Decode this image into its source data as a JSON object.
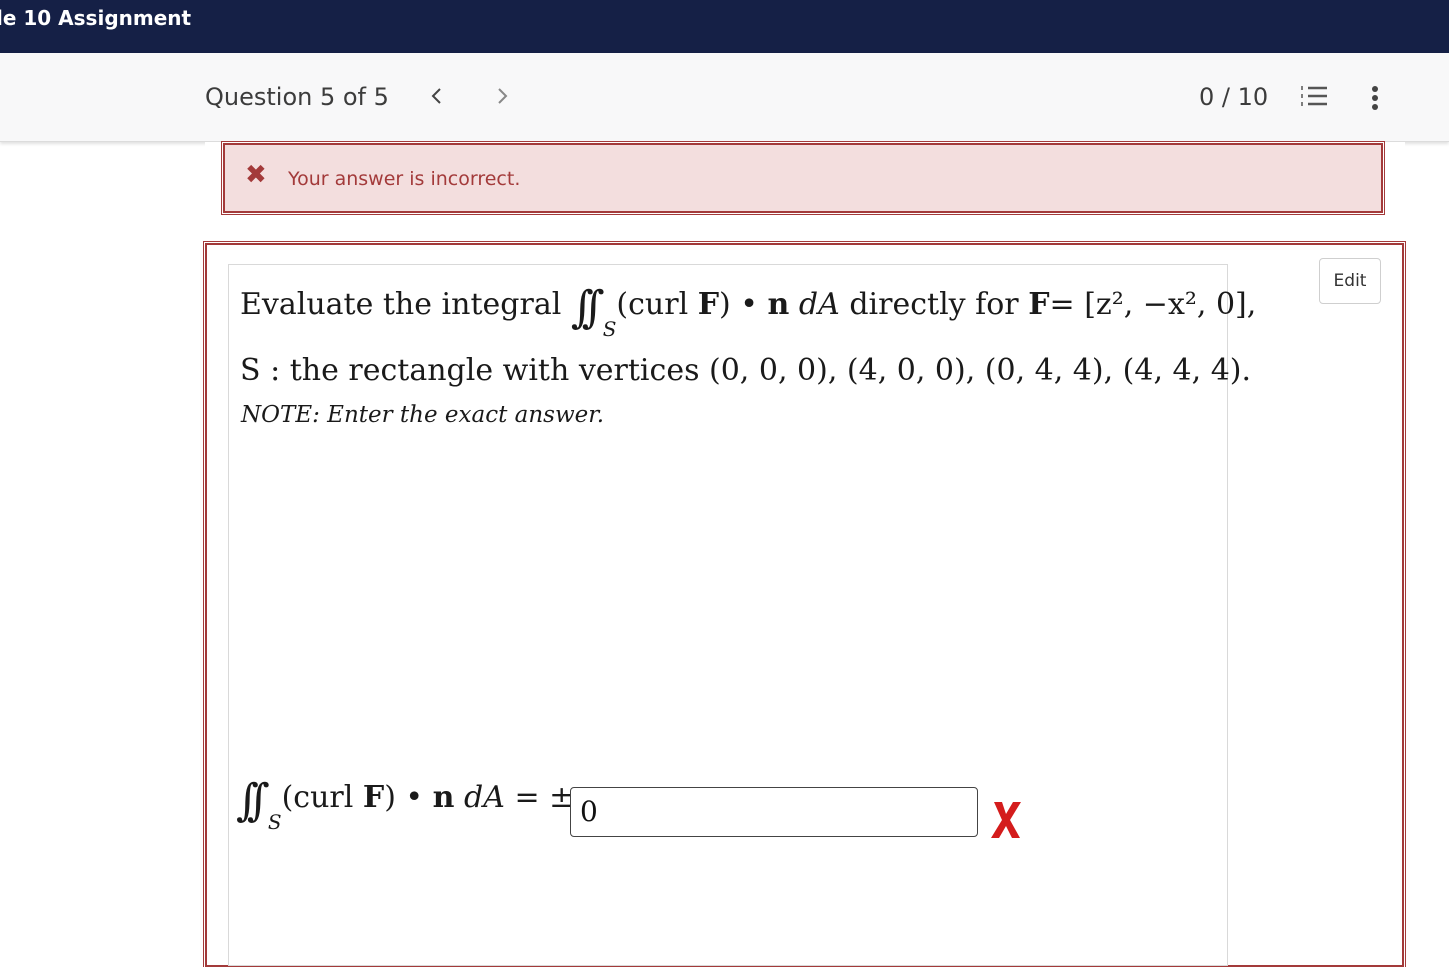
{
  "app": {
    "title": "le 10 Assignment"
  },
  "header": {
    "question_label": "Question 5 of 5",
    "score": "0 / 10"
  },
  "alert": {
    "message": "Your answer is incorrect."
  },
  "question": {
    "edit_label": "Edit",
    "line1": {
      "prefix": "Evaluate the integral",
      "integrand": "(curl",
      "F": "F",
      "dot": ") • ",
      "n": "n",
      "dA": "dA",
      "directly": "directly for",
      "F2": "F",
      "eq": "=",
      "vector": "[z², −x², 0],"
    },
    "line2": "S : the rectangle with vertices (0, 0, 0), (4, 0, 0), (0, 4, 4), (4, 4, 4).",
    "note": "NOTE: Enter the exact answer.",
    "answer": {
      "lhs": "(curl",
      "F": "F",
      "dot": ") • ",
      "n": "n",
      "dA": "dA",
      "rel": "= ±",
      "value": "0",
      "status": "incorrect"
    }
  },
  "colors": {
    "navy": "#152046",
    "error": "#a33a3a",
    "error_bg": "#f3dede",
    "wrong_mark": "#d41c1c"
  }
}
